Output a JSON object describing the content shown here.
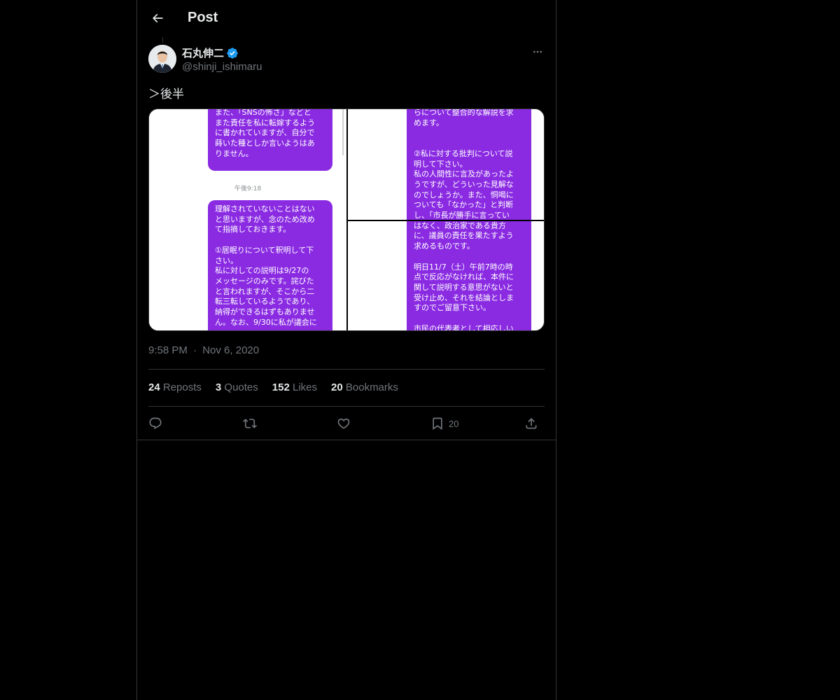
{
  "header": {
    "title": "Post"
  },
  "author": {
    "display_name": "石丸伸二",
    "handle": "@shinji_ishimaru",
    "verified": true
  },
  "post": {
    "text": "＞後半",
    "time": "9:58 PM",
    "separator": "·",
    "date": "Nov 6, 2020"
  },
  "media": {
    "left_bubble_1": "また、「SNSの怖さ」などと\nまた責任を私に転嫁するよう\nに書かれていますが、自分で\n蒔いた種としか言いようはあ\nりません。",
    "left_time": "午後9:18",
    "left_bubble_2": "理解されていないことはない\nと思いますが、念のため改め\nて指摘しておきます。\n\n①居眠りについて釈明して下\nさい。\n私に対しての説明は9/27の\nメッセージのみです。詫びた\nと言われますが、そこから二\n転三転しているようであり、\n納得ができるはずもありませ\nん。なお、9/30に私が議会に",
    "right_bubble": "らについて整合的な解説を求\nめます。\n\n\n②私に対する批判について説\n明して下さい。\n私の人間性に言及があったよ\nうですが、どういった見解な\nのでしょうか。また、恫喝に\nついても「なかった」と判断\nし、「市長が勝手に言ってい\nはなく、政治家である貴方\nに、議員の責任を果たすよう\n求めるものです。\n\n明日11/7（土）午前7時の時\n点で反応がなければ、本件に\n関して説明する意思がないと\n受け止め、それを結論としま\nすのでご留意下さい。\n\n市民の代表者として相応しい"
  },
  "stats": {
    "reposts": {
      "count": "24",
      "label": "Reposts"
    },
    "quotes": {
      "count": "3",
      "label": "Quotes"
    },
    "likes": {
      "count": "152",
      "label": "Likes"
    },
    "bookmarks": {
      "count": "20",
      "label": "Bookmarks"
    }
  },
  "actions": {
    "reply": {
      "icon": "reply-icon"
    },
    "repost": {
      "icon": "repost-icon"
    },
    "like": {
      "icon": "heart-icon"
    },
    "bookmark": {
      "icon": "bookmark-icon",
      "count": "20"
    },
    "share": {
      "icon": "share-icon"
    }
  },
  "colors": {
    "background": "#000000",
    "text": "#e7e9ea",
    "muted": "#71767b",
    "border": "#2f3336",
    "verified": "#1d9bf0",
    "bubble": "#8a2be2"
  }
}
